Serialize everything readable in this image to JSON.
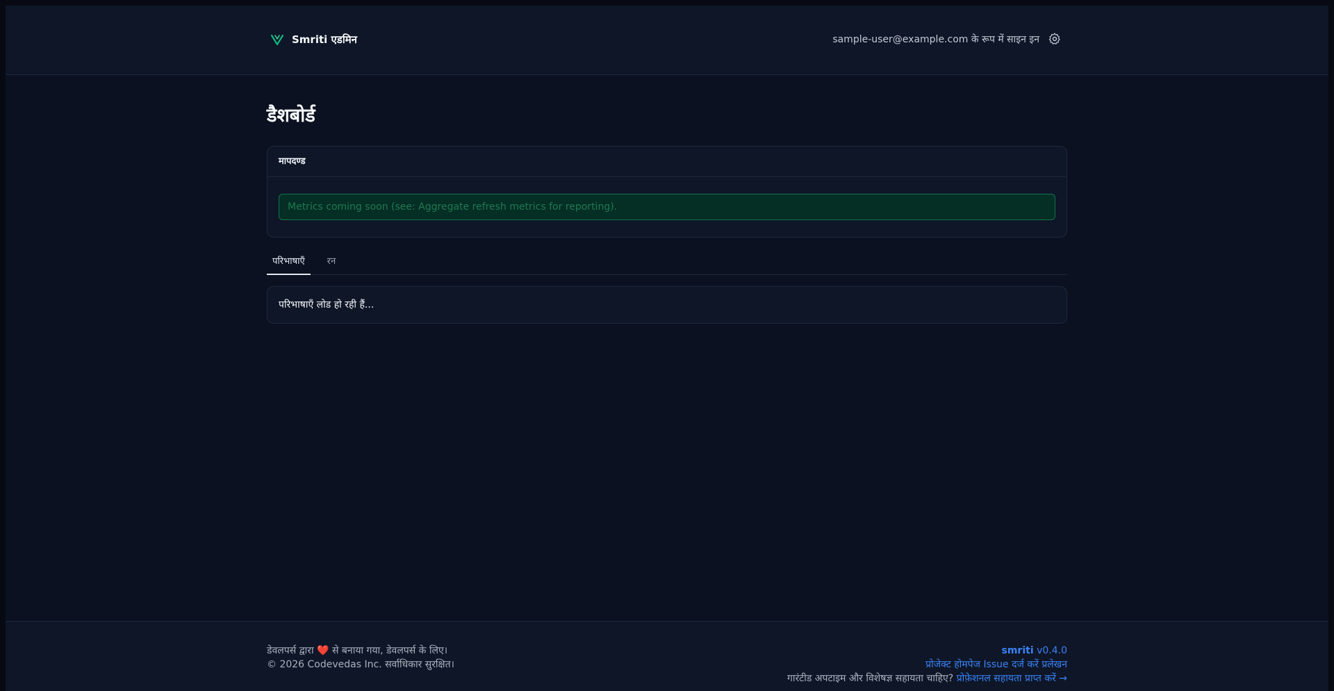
{
  "header": {
    "brand_name": "Smriti एडमिन",
    "user_text": "sample-user@example.com के रूप में साइन इन",
    "logo_icon": "v-logo-icon",
    "settings_icon": "gear-icon"
  },
  "main": {
    "title": "डैशबोर्ड",
    "metrics_card": {
      "header": "मापदण्ड",
      "note": "Metrics coming soon (see: Aggregate refresh metrics for reporting)."
    },
    "tabs": [
      {
        "label": "परिभाषाएँ",
        "active": true
      },
      {
        "label": "रन",
        "active": false
      }
    ],
    "loading_text": "परिभाषाएँ लोड हो रही हैं..."
  },
  "footer": {
    "made_by_before": "डेवलपर्स द्वारा",
    "heart": "❤️",
    "made_by_after": "से बनाया गया, डेवलपर्स के लिए।",
    "copyright": "© 2026 Codevedas Inc. सर्वाधिकार सुरक्षित।",
    "version_brand": "smriti",
    "version": "v0.4.0",
    "link_homepage": "प्रोजेक्ट होमपेज",
    "link_issue": "Issue दर्ज करें",
    "link_docs": "प्रलेखन",
    "support_text": "गारंटीड अपटाइम और विशेषज्ञ सहायता चाहिए?",
    "support_link": "प्रोफ़ेशनल सहायता प्राप्त करें →"
  },
  "colors": {
    "background": "#0b1120",
    "panel": "#0e1627",
    "accent_green": "#10b981",
    "link_blue": "#3b82f6"
  }
}
